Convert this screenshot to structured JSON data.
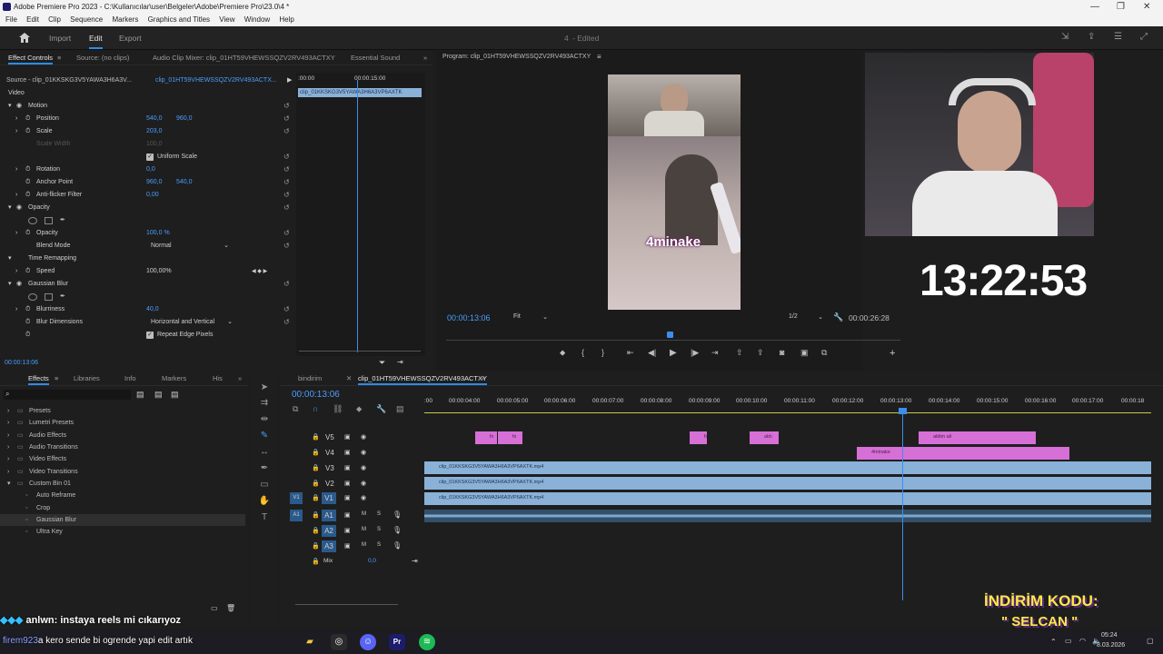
{
  "titlebar": {
    "title": "Adobe Premiere Pro 2023 - C:\\Kullanıcılar\\user\\Belgeler\\Adobe\\Premiere Pro\\23.0\\4 *"
  },
  "menu": [
    "File",
    "Edit",
    "Clip",
    "Sequence",
    "Markers",
    "Graphics and Titles",
    "View",
    "Window",
    "Help"
  ],
  "header": {
    "import": "Import",
    "edit": "Edit",
    "export": "Export",
    "project": "4",
    "edited": "- Edited"
  },
  "source_tabs": {
    "effect_controls": "Effect Controls",
    "source": "Source: (no clips)",
    "mixer": "Audio Clip Mixer: clip_01HT59VHEWSSQZV2RV493ACTXY",
    "essential": "Essential Sound"
  },
  "effect_controls": {
    "source_label": "Source - clip_01KKSKG3V5YAWA3H6A3V...",
    "clip_label": "clip_01HT59VHEWSSQZV2RV493ACTX...",
    "ruler_start": ":00:00",
    "ruler_mid": "00:00:15:00",
    "clip_bar": "clip_01KKSKG3V5YAWA3H6A3VP6AXTK",
    "video": "Video",
    "motion": "Motion",
    "position": "Position",
    "pos_x": "540,0",
    "pos_y": "960,0",
    "scale": "Scale",
    "scale_val": "203,0",
    "scale_width": "Scale Width",
    "scale_width_val": "100,0",
    "uniform": "Uniform Scale",
    "rotation": "Rotation",
    "rotation_val": "0,0",
    "anchor": "Anchor Point",
    "anchor_x": "960,0",
    "anchor_y": "540,0",
    "antiflicker": "Anti-flicker Filter",
    "antiflicker_val": "0,00",
    "opacity_hdr": "Opacity",
    "opacity": "Opacity",
    "opacity_val": "100,0 %",
    "blend": "Blend Mode",
    "blend_val": "Normal",
    "time_remap": "Time Remapping",
    "speed": "Speed",
    "speed_val": "100,00%",
    "gaussian": "Gaussian Blur",
    "blurriness": "Blurriness",
    "blurriness_val": "40,0",
    "blur_dim": "Blur Dimensions",
    "blur_dim_val": "Horizontal and Vertical",
    "repeat": "Repeat Edge Pixels",
    "timecode": "00:00:13:06"
  },
  "program": {
    "tab": "Program: clip_01HT59VHEWSSQZV2RV493ACTXY",
    "timecode": "00:00:13:06",
    "fit": "Fit",
    "res": "1/2",
    "duration": "00:00:26:28",
    "overlay_text": "4minake"
  },
  "webcam": {
    "clock": "13:22:53"
  },
  "effects_panel": {
    "tabs": [
      "Effects",
      "Libraries",
      "Info",
      "Markers",
      "His"
    ],
    "items": [
      "Presets",
      "Lumetri Presets",
      "Audio Effects",
      "Audio Transitions",
      "Video Effects",
      "Video Transitions",
      "Custom Bin 01",
      "Auto Reframe",
      "Crop",
      "Gaussian Blur",
      "Ultra Key"
    ]
  },
  "timeline": {
    "tabs": [
      "bindirim",
      "clip_01HT59VHEWSSQZV2RV493ACTXY"
    ],
    "timecode": "00:00:13:06",
    "ruler": [
      ":00",
      "00:00:04:00",
      "00:00:05:00",
      "00:00:06:00",
      "00:00:07:00",
      "00:00:08:00",
      "00:00:09:00",
      "00:00:10:00",
      "00:00:11:00",
      "00:00:12:00",
      "00:00:13:00",
      "00:00:14:00",
      "00:00:15:00",
      "00:00:16:00",
      "00:00:17:00",
      "00:00:18"
    ],
    "tracks": [
      "V5",
      "V4",
      "V3",
      "V2",
      "V1",
      "A1",
      "A2",
      "A3",
      "Mix"
    ],
    "mix_val": "0,0",
    "clip_aldi": "aldı",
    "clip_aldim": "aldim ali",
    "clip_4minake": "4minake",
    "clip_v3": "clip_01KKSKG3V5YAWA3H6A3VP6AXTK.mp4",
    "clip_v2": "clip_01KKSKG3V5YAWA3H6A3VP6AXTK.mp4",
    "clip_v1": "clip_01KKSKG3V5YAWA3H6A3VP6AXTK.mp4"
  },
  "chat": {
    "line1_user": "anlwn",
    "line1_msg": ": instaya reels mi cıkarıyoz",
    "line2_user": "firem923",
    "line2_msg": "a kero sende bi ogrende yapi edit artık"
  },
  "promo": {
    "title": "İNDİRİM KODU:",
    "code": "\" SELCAN \""
  },
  "taskbar": {
    "time": "05:24",
    "date": "8.03.2026"
  }
}
